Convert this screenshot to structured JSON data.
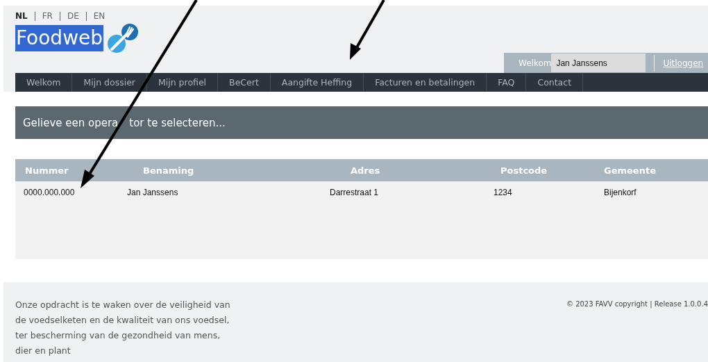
{
  "languages": [
    {
      "label": "NL",
      "selected": true
    },
    {
      "label": "FR",
      "selected": false
    },
    {
      "label": "DE",
      "selected": false
    },
    {
      "label": "EN",
      "selected": false
    }
  ],
  "logo": {
    "text": "Foodweb"
  },
  "user_box": {
    "greeting": "Welkom",
    "user_name": "Jan Janssens",
    "logout": "Uitloggen"
  },
  "nav": [
    {
      "label": "Welkom"
    },
    {
      "label": "Mijn dossier"
    },
    {
      "label": "Mijn profiel"
    },
    {
      "label": "BeCert"
    },
    {
      "label": "Aangifte Heffing"
    },
    {
      "label": "Facturen en betalingen"
    },
    {
      "label": "FAQ"
    },
    {
      "label": "Contact"
    }
  ],
  "page_title": [
    "Gelieve een opera",
    "tor te selecteren..."
  ],
  "table": {
    "columns": [
      "Nummer",
      "Benaming",
      "Adres",
      "Postcode",
      "Gemeente"
    ],
    "rows": [
      [
        "0000.000.000",
        "Jan Janssens",
        "Darrestraat 1",
        "1234",
        "Bijenkorf"
      ]
    ]
  },
  "footer": {
    "mission": "Onze opdracht is te waken over de veiligheid van\nde voedselketen en de kwaliteit van ons voedsel,\nter bescherming van de gezondheid van mens,\ndier en plant",
    "copyright": "© 2023 FAVV copyright | Release 1.0.0.4"
  }
}
